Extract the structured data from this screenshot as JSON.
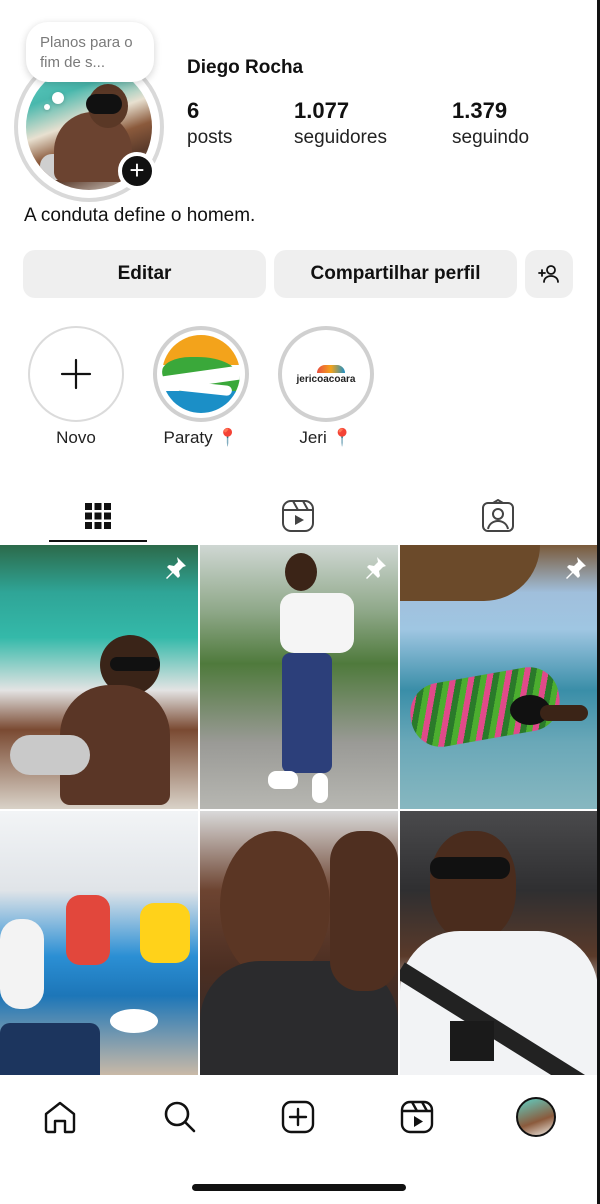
{
  "profile": {
    "username": "Diego Rocha",
    "note": "Planos para o fim de s...",
    "bio": "A conduta define o homem.",
    "stats": {
      "posts_count": "6",
      "posts_label": "posts",
      "followers_count": "1.077",
      "followers_label": "seguidores",
      "following_count": "1.379",
      "following_label": "seguindo"
    }
  },
  "actions": {
    "edit_label": "Editar",
    "share_label": "Compartilhar perfil",
    "add_person_icon": "add-person-icon"
  },
  "highlights": [
    {
      "label": "Novo",
      "icon": "plus-icon"
    },
    {
      "label": "Paraty 📍",
      "cover": "paraty-logo"
    },
    {
      "label": "Jeri 📍",
      "cover": "jericoacoara-logo",
      "cover_text": "jericoacoara"
    }
  ],
  "tabs": [
    {
      "name": "grid",
      "icon": "grid-icon",
      "active": true
    },
    {
      "name": "reels",
      "icon": "reels-icon",
      "active": false
    },
    {
      "name": "tagged",
      "icon": "tagged-icon",
      "active": false
    }
  ],
  "posts": [
    {
      "pinned": true,
      "subject": "man on boat with drink, turquoise water"
    },
    {
      "pinned": true,
      "subject": "man in white polo standing by fence"
    },
    {
      "pinned": true,
      "subject": "man in hammock over water"
    },
    {
      "pinned": false,
      "subject": "group by swimming pool"
    },
    {
      "pinned": false,
      "subject": "selfie close-up"
    },
    {
      "pinned": false,
      "subject": "selfie in car with sunglasses"
    }
  ],
  "bottom_nav": [
    {
      "name": "home",
      "icon": "home-icon"
    },
    {
      "name": "search",
      "icon": "search-icon"
    },
    {
      "name": "create",
      "icon": "create-icon"
    },
    {
      "name": "reels",
      "icon": "reels-icon"
    },
    {
      "name": "profile",
      "icon": "avatar"
    }
  ],
  "colors": {
    "button_bg": "#efefef",
    "text": "#111111",
    "muted": "#7a7a7a"
  }
}
